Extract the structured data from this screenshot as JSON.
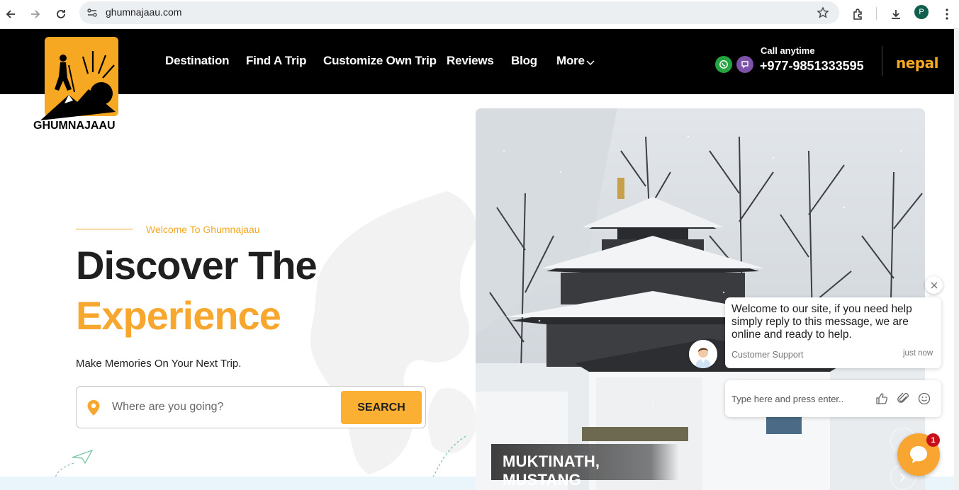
{
  "browser": {
    "url": "ghumnajaau.com",
    "profile_initial": "P"
  },
  "header": {
    "logo_text": "GHUMNAJAAU",
    "nav": [
      "Destination",
      "Find A Trip",
      "Customize Own Trip",
      "Reviews",
      "Blog",
      "More"
    ],
    "call_label": "Call anytime",
    "phone": "+977-9851333595",
    "badge": "nepal"
  },
  "hero": {
    "welcome": "Welcome To Ghumnajaau",
    "headline_line1": "Discover The",
    "headline_line2": "Experience",
    "tagline": "Make Memories On Your Next Trip.",
    "search_placeholder": "Where are you going?",
    "search_button": "SEARCH",
    "photo_caption": "MUKTINATH, MUSTANG"
  },
  "chat": {
    "message": "Welcome to our site, if you need help simply reply to this message, we are online and ready to help.",
    "agent": "Customer Support",
    "time": "just now",
    "input_placeholder": "Type here and press enter..",
    "unread": "1"
  },
  "colors": {
    "accent": "#f7a72e",
    "header_bg": "#000000",
    "whatsapp": "#25a541",
    "viber": "#7d52a8",
    "badge": "#c8101a"
  }
}
